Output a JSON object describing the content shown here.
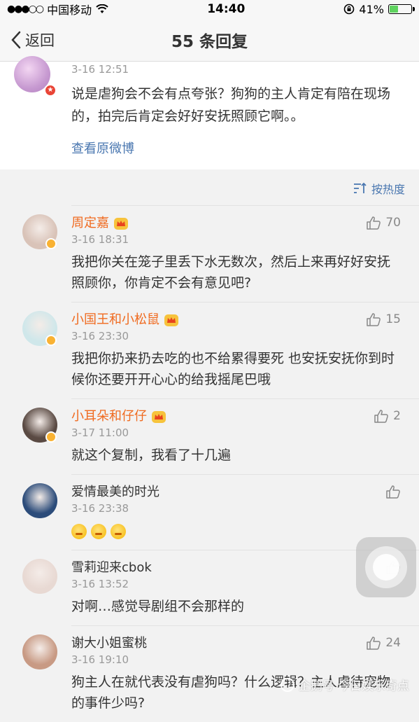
{
  "status_bar": {
    "carrier": "中国移动",
    "time": "14:40",
    "battery_percent": "41%",
    "battery_level": 0.41
  },
  "nav": {
    "back_label": "返回",
    "title": "55 条回复"
  },
  "original_post": {
    "time": "3-16 12:51",
    "text": "说是虐狗会不会有点夸张？狗狗的主人肯定有陪在现场的，拍完后肯定会好好安抚照顾它啊。。",
    "view_original": "查看原微博"
  },
  "sort": {
    "label": "按热度"
  },
  "comments": [
    {
      "name": "周定嘉",
      "vip": true,
      "time": "3-16 18:31",
      "likes": "70",
      "text": "我把你关在笼子里丢下水无数次，然后上来再好好安抚照顾你，你肯定不会有意见吧?",
      "avatar_color": "#d9c3b8"
    },
    {
      "name": "小国王和小松鼠",
      "vip": true,
      "time": "3-16 23:30",
      "likes": "15",
      "text": "我把你扔来扔去吃的也不给累得要死 也安抚安抚你到时候你还要开开心心的给我摇尾巴哦",
      "avatar_color": "#cfe7ea"
    },
    {
      "name": "小耳朵和仔仔",
      "vip": true,
      "time": "3-17 11:00",
      "likes": "2",
      "text": "就这个复制，我看了十几遍",
      "avatar_color": "#5a4a43"
    },
    {
      "name": "爱情最美的时光",
      "vip": false,
      "time": "3-16 23:38",
      "likes": "",
      "text": "",
      "emoji_count": 3,
      "avatar_color": "#2c4c7a"
    },
    {
      "name": "雪莉迎来cbok",
      "vip": false,
      "time": "3-16 13:52",
      "likes": "",
      "text": "对啊…感觉导剧组不会那样的",
      "avatar_color": "#e8d9d3"
    },
    {
      "name": "谢大小姐蜜桃",
      "vip": false,
      "time": "3-16 19:10",
      "likes": "24",
      "text": "狗主人在就代表没有虐狗吗？什么逻辑？主人虐待宠物的事件少吗?",
      "avatar_color": "#c89a84"
    }
  ],
  "watermark": "企鹅号 今日娱乐奇点"
}
